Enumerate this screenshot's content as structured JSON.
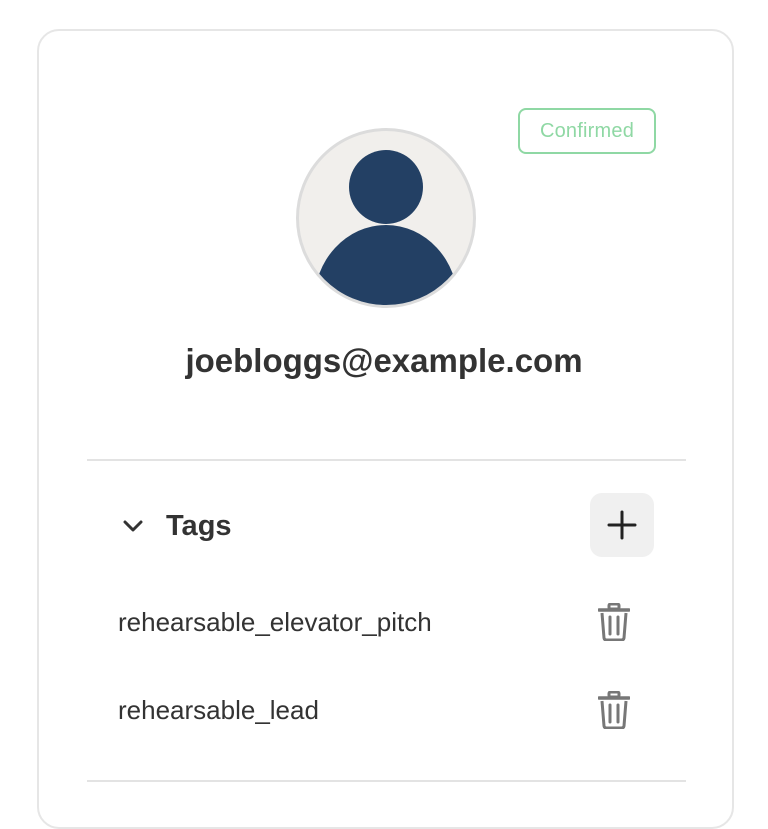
{
  "profile": {
    "status_badge": "Confirmed",
    "email": "joebloggs@example.com",
    "avatar_icon": "user-silhouette-icon"
  },
  "tags_section": {
    "title": "Tags",
    "expanded": true,
    "toggle_icon": "chevron-down-icon",
    "add_icon": "plus-icon",
    "items": [
      {
        "label": "rehearsable_elevator_pitch",
        "delete_icon": "trash-icon"
      },
      {
        "label": "rehearsable_lead",
        "delete_icon": "trash-icon"
      }
    ]
  },
  "colors": {
    "badge": "#8fd8a4",
    "avatar_figure": "#234064",
    "avatar_bg": "#f1efec",
    "text": "#333333",
    "add_button_bg": "#f0f0f0"
  }
}
